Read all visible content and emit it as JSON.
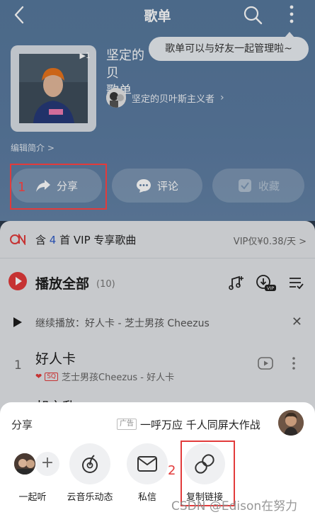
{
  "header": {
    "title": "歌单",
    "tooltip": "歌单可以与好友一起管理啦~"
  },
  "playlist": {
    "name": "坚定的贝叶斯主义者歌单",
    "name_visible": "坚定的贝",
    "name_line2": "歌单",
    "creator": "坚定的贝叶斯主义者",
    "edit_intro": "编辑简介 >",
    "cover_play_glyph": "▶1"
  },
  "actions": {
    "share": "分享",
    "comment": "评论",
    "favorite": "收藏"
  },
  "annotations": {
    "mark1": "1",
    "mark2": "2"
  },
  "vip": {
    "text_prefix": "含",
    "count": "4",
    "text_suffix": "首 VIP 专享歌曲",
    "price": "VIP仅¥0.38/天 >"
  },
  "play_all": {
    "label": "播放全部",
    "count": "(10)"
  },
  "continue": {
    "text": "继续播放：好人卡 - 芝士男孩 Cheezus"
  },
  "songs": [
    {
      "index": "1",
      "title": "好人卡",
      "quality": "SQ",
      "artist": "芝士男孩Cheezus - 好人卡"
    },
    {
      "index": "",
      "title": "胡言乱",
      "quality": "",
      "artist": ""
    }
  ],
  "share_sheet": {
    "title": "分享",
    "ad_badge": "广告",
    "ad_text": "一呼万应 千人同屏大作战",
    "items": [
      {
        "label": "一起听",
        "icon": "listen-together-icon"
      },
      {
        "label": "云音乐动态",
        "icon": "moments-icon"
      },
      {
        "label": "私信",
        "icon": "mail-icon"
      },
      {
        "label": "复制链接",
        "icon": "link-icon"
      }
    ]
  },
  "watermark": "CSDN @Edison在努力",
  "colors": {
    "header_blue": "#5a7aa0",
    "accent_red": "#e23b3b",
    "vip_blue": "#2f5cc5"
  }
}
